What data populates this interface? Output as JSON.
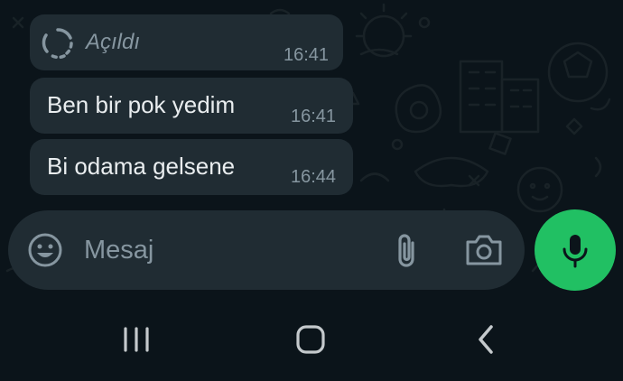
{
  "messages": [
    {
      "text": "Açıldı",
      "time": "16:41",
      "kind": "view-once-opened"
    },
    {
      "text": "Ben bir pok yedim",
      "time": "16:41",
      "kind": "text"
    },
    {
      "text": "Bi odama gelsene",
      "time": "16:44",
      "kind": "text"
    }
  ],
  "composer": {
    "placeholder": "Mesaj",
    "value": "",
    "icons": {
      "emoji": "emoji-icon",
      "attach": "paperclip-icon",
      "camera": "camera-icon",
      "send": "microphone-icon"
    }
  },
  "navbar": {
    "icons": [
      "recent-apps-icon",
      "home-icon",
      "back-icon"
    ]
  },
  "colors": {
    "background": "#0b141a",
    "bubble": "#202c33",
    "text": "#e9edef",
    "secondary_text": "#8696a0",
    "accent_green": "#21c063"
  }
}
